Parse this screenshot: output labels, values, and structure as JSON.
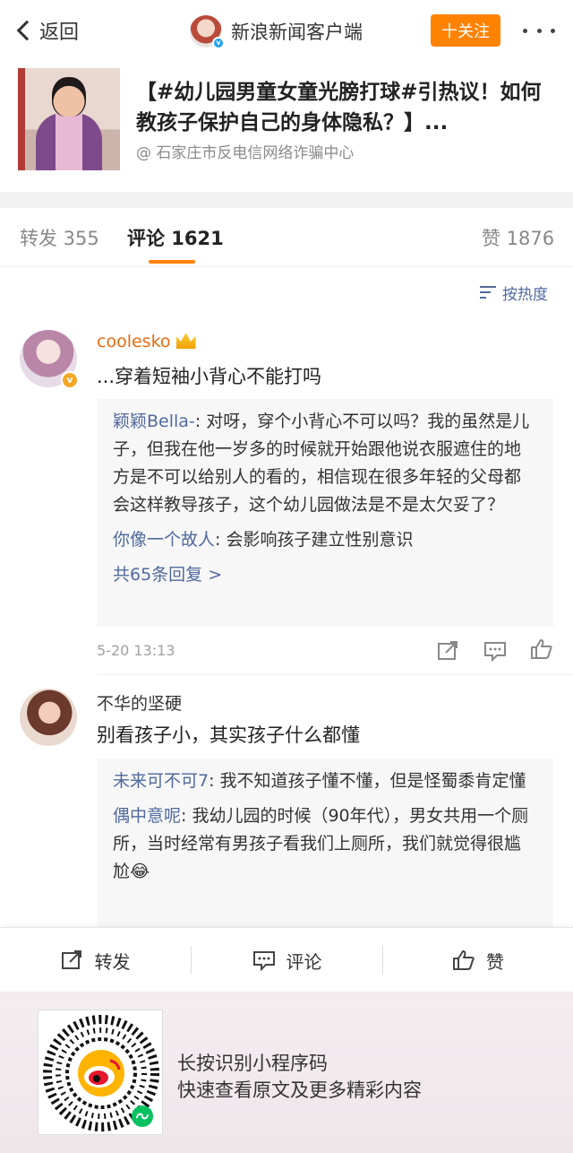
{
  "nav": {
    "back_label": "返回",
    "account_name": "新浪新闻客户端",
    "follow_label": "十关注"
  },
  "article": {
    "title": "【#幼儿园男童女童光膀打球#引热议！如何教孩子保护自己的身体隐私？】...",
    "source": "@ 石家庄市反电信网络诈骗中心"
  },
  "tabs": {
    "repost": "转发 355",
    "comment": "评论 1621",
    "like": "赞 1876"
  },
  "sort_label": "按热度",
  "comments": [
    {
      "author": "coolesko",
      "text": "...穿着短袖小背心不能打吗",
      "replies": [
        {
          "name": "颖颖Bella-",
          "text": ": 对呀，穿个小背心不可以吗？我的虽然是儿子，但我在他一岁多的时候就开始跟他说衣服遮住的地方是不可以给别人的看的，相信现在很多年轻的父母都会这样教导孩子，这个幼儿园做法是不是太欠妥了？"
        },
        {
          "name": "你像一个故人",
          "text": ": 会影响孩子建立性别意识"
        }
      ],
      "reply_count": "共65条回复 >",
      "time": "5-20 13:13"
    },
    {
      "author": "不华的坚硬",
      "text": "别看孩子小，其实孩子什么都懂",
      "replies": [
        {
          "name": "未来可不可7",
          "text": ": 我不知道孩子懂不懂，但是怪蜀黍肯定懂"
        },
        {
          "name": "偶中意呢",
          "text": ": 我幼儿园的时候（90年代），男女共用一个厕所，当时经常有男孩子看我们上厕所，我们就觉得很尴尬😂"
        }
      ]
    }
  ],
  "actionbar": {
    "repost": "转发",
    "comment": "评论",
    "like": "赞"
  },
  "footer": {
    "line1": "长按识别小程序码",
    "line2": "快速查看原文及更多精彩内容"
  },
  "colors": {
    "accent": "#ff8200",
    "link": "#506a9e",
    "vip_name": "#e86b10"
  },
  "icons": [
    "back-chevron-icon",
    "more-icon",
    "sort-icon",
    "crown-icon",
    "share-icon",
    "comment-icon",
    "like-icon",
    "weibo-logo-icon",
    "mini-program-icon"
  ]
}
